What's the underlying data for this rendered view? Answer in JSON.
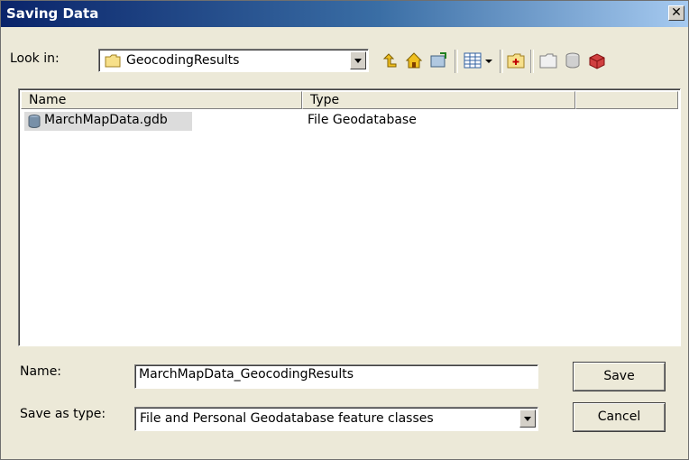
{
  "window": {
    "title": "Saving Data",
    "close_label": "✕"
  },
  "look_in": {
    "label": "Look in:",
    "value": "GeocodingResults"
  },
  "toolbar": {
    "icons": [
      "up-one-level-icon",
      "home-icon",
      "connect-folder-icon",
      "view-options-icon",
      "new-folder-icon",
      "new-file-geodatabase-icon",
      "new-personal-geodatabase-icon",
      "toolbox-icon"
    ]
  },
  "list": {
    "columns": [
      "Name",
      "Type",
      ""
    ],
    "rows": [
      {
        "name": "MarchMapData.gdb",
        "type": "File Geodatabase"
      }
    ]
  },
  "name_field": {
    "label": "Name:",
    "value": "MarchMapData_GeocodingResults"
  },
  "save_as_type": {
    "label": "Save as type:",
    "value": "File and Personal Geodatabase feature classes"
  },
  "buttons": {
    "save": "Save",
    "cancel": "Cancel"
  }
}
